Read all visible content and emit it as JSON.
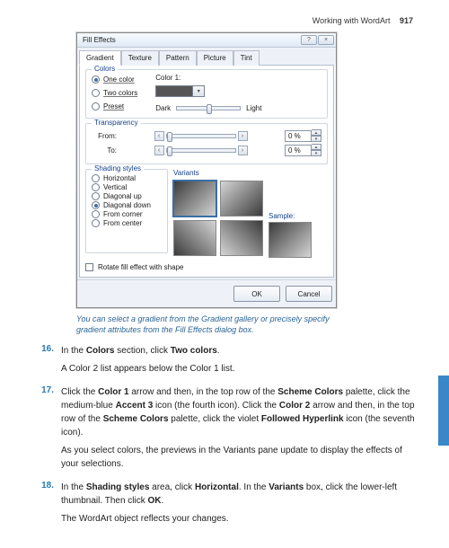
{
  "header": {
    "section": "Working with WordArt",
    "page": "917"
  },
  "dialog": {
    "title": "Fill Effects",
    "tabs": [
      "Gradient",
      "Texture",
      "Pattern",
      "Picture",
      "Tint"
    ],
    "colors": {
      "group": "Colors",
      "one": "One color",
      "two": "Two colors",
      "preset": "Preset",
      "color1": "Color 1:",
      "dark": "Dark",
      "light": "Light"
    },
    "transparency": {
      "group": "Transparency",
      "from": "From:",
      "to": "To:",
      "fromVal": "0 %",
      "toVal": "0 %"
    },
    "shading": {
      "group": "Shading styles",
      "horizontal": "Horizontal",
      "vertical": "Vertical",
      "diagup": "Diagonal up",
      "diagdown": "Diagonal down",
      "fromcorner": "From corner",
      "fromcenter": "From center"
    },
    "variants": "Variants",
    "sample": "Sample:",
    "rotate": "Rotate fill effect with shape",
    "ok": "OK",
    "cancel": "Cancel"
  },
  "caption": "You can select a gradient from the Gradient gallery or precisely specify gradient attributes from the Fill Effects dialog box.",
  "steps": {
    "s16a": "In the ",
    "s16b": "Colors",
    "s16c": " section, click ",
    "s16d": "Two colors",
    "s16e": ".",
    "s16f": "A Color 2 list appears below the Color 1 list.",
    "s17a": "Click the ",
    "s17b": "Color 1",
    "s17c": " arrow and then, in the top row of the ",
    "s17d": "Scheme Colors",
    "s17e": " palette, click the medium-blue ",
    "s17f": "Accent 3",
    "s17g": " icon (the fourth icon). Click the ",
    "s17h": "Color 2",
    "s17i": " arrow and then, in the top row of the ",
    "s17j": "Scheme Colors",
    "s17k": " palette, click the violet ",
    "s17l": "Followed Hyperlink",
    "s17m": " icon (the seventh icon).",
    "s17n": "As you select colors, the previews in the Variants pane update to display the effects of your selections.",
    "s18a": "In the ",
    "s18b": "Shading styles",
    "s18c": " area, click ",
    "s18d": "Horizontal",
    "s18e": ". In the ",
    "s18f": "Variants",
    "s18g": " box, click the lower-left thumbnail. Then click ",
    "s18h": "OK",
    "s18i": ".",
    "s18j": "The WordArt object reflects your changes."
  },
  "nums": {
    "n16": "16.",
    "n17": "17.",
    "n18": "18."
  }
}
